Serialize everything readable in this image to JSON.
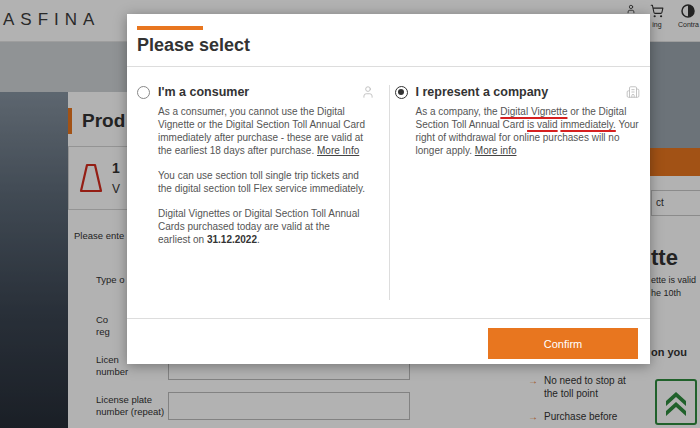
{
  "header": {
    "logo": "ASFINA",
    "cart_label": "ing",
    "contrast_label": "Contra"
  },
  "page": {
    "heading": "Prod",
    "product_card": {
      "title": "1",
      "subtitle": "V"
    },
    "form_intro": "Please ente",
    "fields": [
      {
        "label_lines": [
          "Type o"
        ]
      },
      {
        "label_lines": [
          "Co",
          "reg"
        ]
      },
      {
        "label_lines": [
          "Licen",
          "number"
        ]
      },
      {
        "label_lines": [
          "License plate",
          "number (repeat)"
        ]
      }
    ]
  },
  "sidebar": {
    "select_button": "ct",
    "title": "tte",
    "text_lines": [
      "ette is valid",
      "he 10th"
    ],
    "benefits_heading": "on you",
    "benefits": [
      {
        "arrow": "→",
        "lines": [
          "No need to stop at",
          "the toll point"
        ]
      },
      {
        "arrow": "→",
        "lines": [
          "Purchase before"
        ]
      }
    ]
  },
  "dialog": {
    "title": "Please select",
    "confirm": "Confirm",
    "options": [
      {
        "label": "I'm a consumer",
        "kind": "consumer",
        "selected": false,
        "paragraphs": [
          [
            [
              {
                "text": "As a consumer, you cannot use the Digital Vignette or the Digital Section Toll Annual Card immediately after purchase - these are valid at the earliest 18 days after purchase. ",
                "kind": "text",
                "annotated": false
              },
              {
                "text": "More Info",
                "kind": "link",
                "annotated": false
              }
            ]
          ],
          [
            [
              {
                "text": "You can use section toll single trip tickets and the digital section toll Flex service immediately.",
                "kind": "text",
                "annotated": false
              }
            ]
          ],
          [
            [
              {
                "text": "Digital Vignettes or Digital Section Toll Annual Cards purchased today are valid at the",
                "kind": "text",
                "annotated": false
              }
            ],
            [
              {
                "text": "earliest on ",
                "kind": "text",
                "annotated": false
              },
              {
                "text": "31.12.2022",
                "kind": "bold",
                "annotated": false
              },
              {
                "text": ".",
                "kind": "text",
                "annotated": false
              }
            ]
          ]
        ]
      },
      {
        "label": "I represent a company",
        "kind": "company",
        "selected": true,
        "paragraphs": [
          [
            [
              {
                "text": "As a company, the ",
                "kind": "text",
                "annotated": false
              },
              {
                "text": "Digital Vignette",
                "kind": "text",
                "annotated": true
              },
              {
                "text": " or the Digital Section Toll Annual Card ",
                "kind": "text",
                "annotated": false
              },
              {
                "text": "is valid",
                "kind": "text",
                "annotated": true
              },
              {
                "text": " ",
                "kind": "text",
                "annotated": false
              },
              {
                "text": "immediately.",
                "kind": "text",
                "annotated": true
              },
              {
                "text": " Your right of withdrawal for online purchases will no longer apply. ",
                "kind": "text",
                "annotated": false
              },
              {
                "text": "More info",
                "kind": "link",
                "annotated": false
              }
            ]
          ]
        ]
      }
    ]
  }
}
